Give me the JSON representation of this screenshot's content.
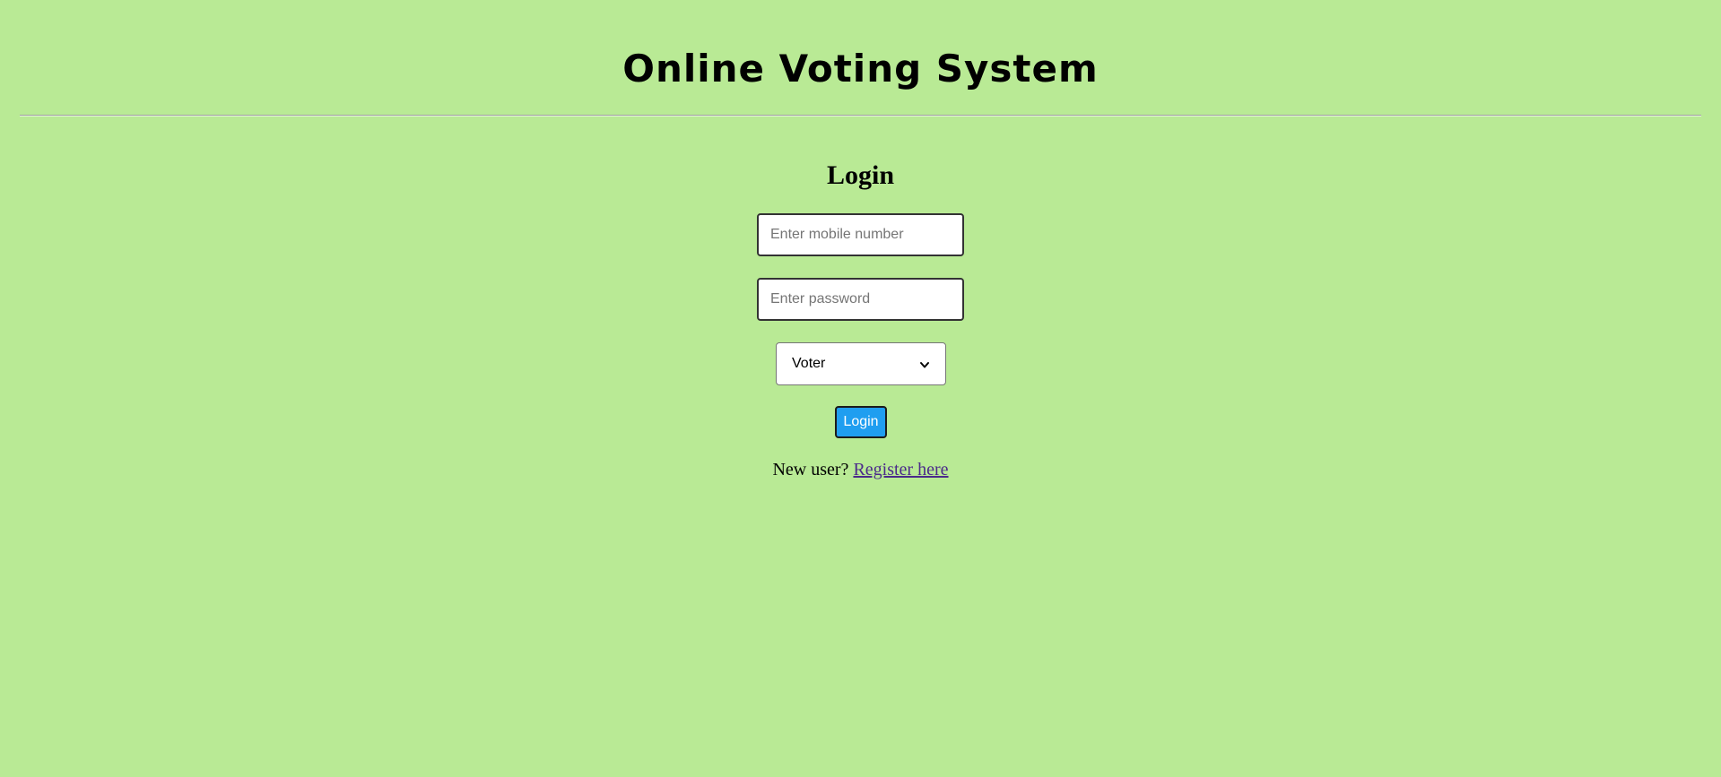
{
  "header": {
    "title": "Online Voting System"
  },
  "login": {
    "heading": "Login",
    "mobile_placeholder": "Enter mobile number",
    "password_placeholder": "Enter password",
    "role_selected": "Voter",
    "submit_label": "Login",
    "new_user_text": "New user?",
    "register_link_text": "Register here"
  },
  "colors": {
    "background": "#b9ea95",
    "button": "#1f9ef0",
    "link": "#4b2a8a"
  },
  "icons": {
    "select_arrow": "chevron-down-icon"
  }
}
